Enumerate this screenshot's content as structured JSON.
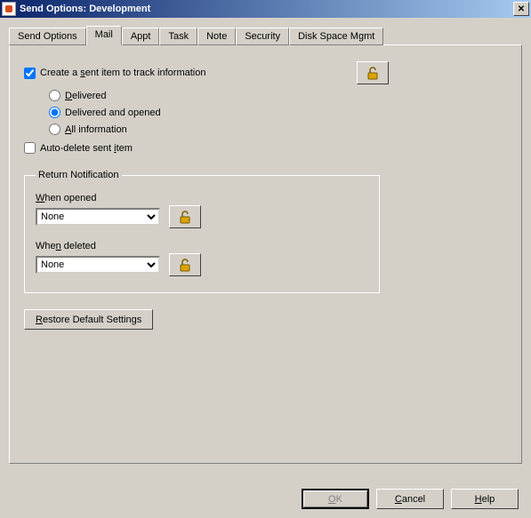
{
  "window": {
    "title": "Send Options:  Development"
  },
  "tabs": {
    "0": {
      "label": "Send Options"
    },
    "1": {
      "label": "Mail"
    },
    "2": {
      "label": "Appt"
    },
    "3": {
      "label": "Task"
    },
    "4": {
      "label": "Note"
    },
    "5": {
      "label": "Security"
    },
    "6": {
      "label": "Disk Space Mgmt"
    }
  },
  "mail": {
    "create_sent_prefix": "Create a ",
    "create_sent_u": "s",
    "create_sent_suffix": "ent item to track information",
    "delivered_u": "D",
    "delivered_rest": "elivered",
    "delivered_opened": "Delivered and opened",
    "allinfo_u": "A",
    "allinfo_rest": "ll information",
    "autodel_prefix": "Auto-delete sent ",
    "autodel_u": "i",
    "autodel_suffix": "tem"
  },
  "return_notif": {
    "legend": "Return Notification",
    "when_opened_u": "W",
    "when_opened_rest": "hen opened",
    "opened_value": "None",
    "when_deleted_prefix": "Whe",
    "when_deleted_u": "n",
    "when_deleted_suffix": " deleted",
    "deleted_value": "None"
  },
  "restore": {
    "u": "R",
    "rest": "estore Default Settings"
  },
  "footer": {
    "ok_u": "O",
    "ok_rest": "K",
    "cancel_u": "C",
    "cancel_rest": "ancel",
    "help_u": "H",
    "help_rest": "elp"
  }
}
